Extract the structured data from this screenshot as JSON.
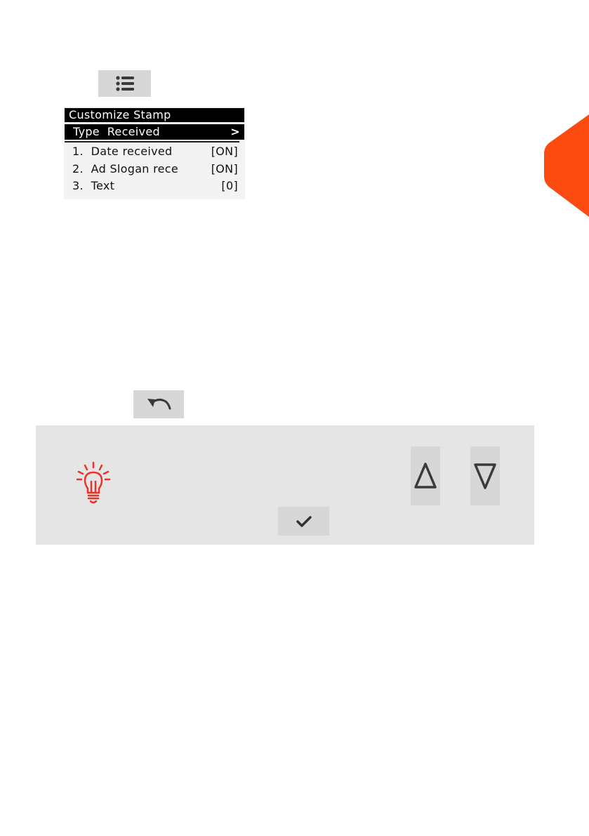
{
  "colors": {
    "accent": "#fb4b11",
    "tip_red": "#e8332a",
    "button_gray": "#d7d7d7",
    "panel_gray": "#e5e5e5"
  },
  "icons": {
    "menu": "list-icon",
    "back": "undo-arrow-icon",
    "tip": "lightbulb-icon",
    "up": "triangle-up-icon",
    "down": "triangle-down-icon",
    "ok": "checkmark-icon"
  },
  "screen": {
    "title": "Customize Stamp",
    "subtitle": "Type  Received",
    "chevron": ">",
    "items": [
      {
        "label": "1.  Date received",
        "value": "[ON]"
      },
      {
        "label": "2.  Ad Slogan rece",
        "value": "[ON]"
      },
      {
        "label": "3.  Text",
        "value": "[0]"
      }
    ]
  }
}
